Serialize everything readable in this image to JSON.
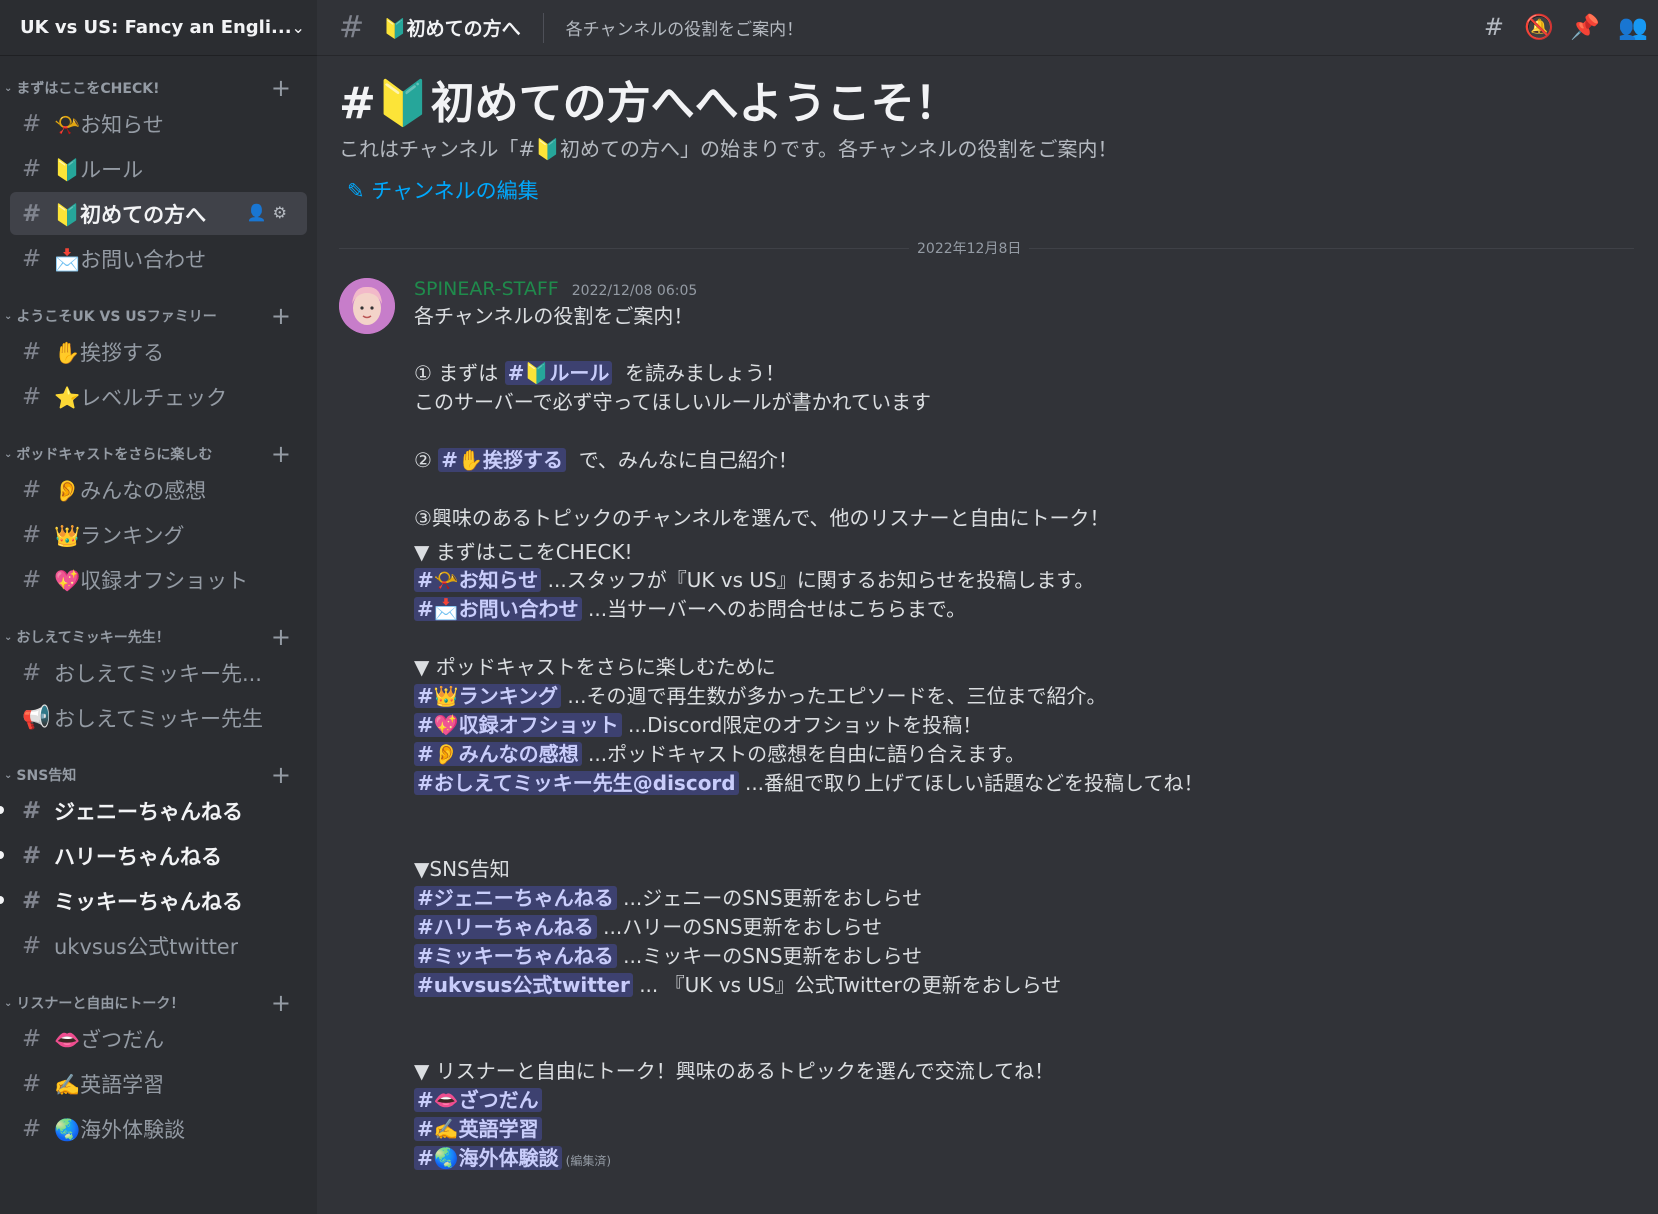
{
  "server": {
    "name": "UK vs US: Fancy an Engli..."
  },
  "sidebar": {
    "categories": [
      {
        "name": "まずはここをCHECK!",
        "channels": [
          "📯お知らせ",
          "🔰ルール",
          "🔰初めての方へ",
          "📩お問い合わせ"
        ]
      },
      {
        "name": "ようこそUK VS USファミリー",
        "channels": [
          "✋挨拶する",
          "⭐レベルチェック"
        ]
      },
      {
        "name": "ポッドキャストをさらに楽しむ",
        "channels": [
          "👂みんなの感想",
          "👑ランキング",
          "💖収録オフショット"
        ]
      },
      {
        "name": "おしえてミッキー先生！",
        "channels": [
          "おしえてミッキー先...",
          "おしえてミッキー先生"
        ]
      },
      {
        "name": "SNS告知",
        "channels": [
          "ジェニーちゃんねる",
          "ハリーちゃんねる",
          "ミッキーちゃんねる",
          "ukvsus公式twitter"
        ]
      },
      {
        "name": "リスナーと自由にトーク！",
        "channels": [
          "👄ざつだん",
          "✍️英語学習",
          "🌏海外体験談"
        ]
      }
    ]
  },
  "topbar": {
    "channel": "🔰初めての方へ",
    "topic": "各チャンネルの役割をご案内！"
  },
  "welcome": {
    "title": "#🔰初めての方へへようこそ！",
    "subtitle": "これはチャンネル「#🔰初めての方へ」の始まりです。各チャンネルの役割をご案内！",
    "edit_link": "チャンネルの編集"
  },
  "date_divider": "2022年12月8日",
  "message": {
    "author": "SPINEAR-STAFF",
    "timestamp": "2022/12/08 06:05",
    "edited_label": "(編集済)",
    "m": {
      "rules": "#🔰ルール",
      "greet": "#✋挨拶する",
      "news": "#📯お知らせ",
      "contact": "#📩お問い合わせ",
      "ranking": "#👑ランキング",
      "offshot": "#💖収録オフショット",
      "impressions": "#👂みんなの感想",
      "mickey": "#おしえてミッキー先生@discord",
      "jenny": "#ジェニーちゃんねる",
      "harry": "#ハリーちゃんねる",
      "mickeych": "#ミッキーちゃんねる",
      "twitter": "#ukvsus公式twitter",
      "chat": "#👄ざつだん",
      "english": "#✍️英語学習",
      "abroad": "#🌏海外体験談"
    },
    "t": {
      "intro": "各チャンネルの役割をご案内！",
      "step1_pre": "① まずは",
      "step1_post": "を読みましょう！",
      "step1_desc": "このサーバーで必ず守ってほしいルールが書かれています",
      "step2_pre": "②",
      "step2_post": "で、みんなに自己紹介！",
      "step3": "③興味のあるトピックのチャンネルを選んで、他のリスナーと自由にトーク！",
      "sec_check": "▼ まずはここをCHECK!",
      "news_desc": "...スタッフが『UK vs US』に関するお知らせを投稿します。",
      "contact_desc": "...当サーバーへのお問合せはこちらまで。",
      "sec_podcast": "▼ ポッドキャストをさらに楽しむために",
      "ranking_desc": "...その週で再生数が多かったエピソードを、三位まで紹介。",
      "offshot_desc": "...Discord限定のオフショットを投稿！",
      "impressions_desc": "...ポッドキャストの感想を自由に語り合えます。",
      "mickey_desc": "...番組で取り上げてほしい話題などを投稿してね！",
      "sec_sns": "▼SNS告知",
      "jenny_desc": "...ジェニーのSNS更新をおしらせ",
      "harry_desc": "...ハリーのSNS更新をおしらせ",
      "mickeych_desc": "...ミッキーのSNS更新をおしらせ",
      "twitter_desc": "... 『UK vs US』公式Twitterの更新をおしらせ",
      "sec_talk": "▼ リスナーと自由にトーク！興味のあるトピックを選んで交流してね！"
    }
  }
}
